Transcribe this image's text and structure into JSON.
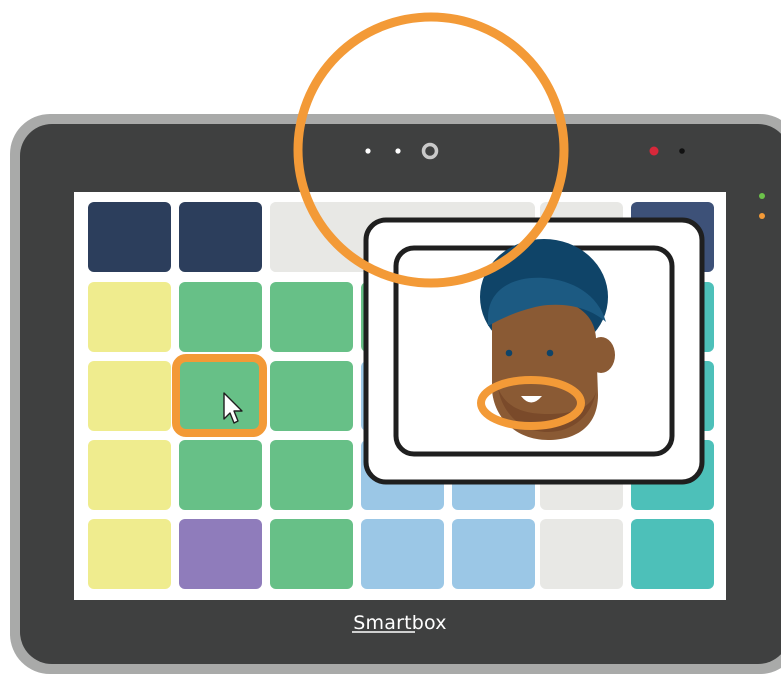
{
  "device": {
    "brand": "Smartbox",
    "colors": {
      "outer_frame": "#a9aaa9",
      "bezel": "#3f4040",
      "screen": "#ffffff",
      "camera_dot": "#ffffff",
      "power_led": "#d7283a",
      "side_led_green": "#6cc24a",
      "side_led_orange": "#f39a37"
    }
  },
  "grid": {
    "colors": {
      "navy": "#2c3e5c",
      "navy_light": "#3d5178",
      "grey": "#e8e8e5",
      "yellow": "#efec8e",
      "green": "#67c087",
      "blue": "#9bc7e6",
      "teal": "#4dc0b9",
      "purple": "#8f7cbb",
      "selection": "#f39a37"
    },
    "rows": [
      [
        "navy",
        "navy",
        "grey",
        "grey",
        "grey",
        "grey",
        "navy_light",
        "navy_light"
      ],
      [
        "yellow",
        "green",
        "green",
        "green",
        "blue",
        "grey",
        "teal",
        "teal"
      ],
      [
        "yellow",
        "green",
        "green",
        "blue",
        "blue",
        "grey",
        "teal",
        "teal"
      ],
      [
        "yellow",
        "green",
        "green",
        "blue",
        "blue",
        "grey",
        "teal",
        "teal"
      ],
      [
        "yellow",
        "purple",
        "green",
        "blue",
        "blue",
        "grey",
        "teal",
        "teal"
      ]
    ],
    "selected_cell": {
      "row": 2,
      "col": 1
    }
  },
  "highlights": {
    "color": "#f39a37",
    "camera_ring": "camera-highlight-circle",
    "mouth_ring": "mouth-highlight-ellipse"
  },
  "face_card": {
    "border_color": "#1f1f1f",
    "hair": "#0f4468",
    "hair_shade": "#1c5a82",
    "skin": "#8a5a34",
    "beard": "#7a4a2a"
  }
}
